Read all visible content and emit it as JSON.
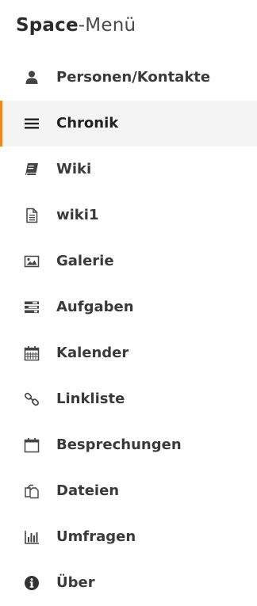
{
  "header": {
    "title_strong": "Space",
    "title_light": "-Menü"
  },
  "menu": {
    "items": [
      {
        "label": "Personen/Kontakte",
        "icon": "user-icon",
        "active": false
      },
      {
        "label": "Chronik",
        "icon": "bars-icon",
        "active": true
      },
      {
        "label": "Wiki",
        "icon": "book-icon",
        "active": false
      },
      {
        "label": "wiki1",
        "icon": "file-text-icon",
        "active": false
      },
      {
        "label": "Galerie",
        "icon": "image-icon",
        "active": false
      },
      {
        "label": "Aufgaben",
        "icon": "tasks-icon",
        "active": false
      },
      {
        "label": "Kalender",
        "icon": "calendar-icon",
        "active": false
      },
      {
        "label": "Linkliste",
        "icon": "link-icon",
        "active": false
      },
      {
        "label": "Besprechungen",
        "icon": "calendar-o-icon",
        "active": false
      },
      {
        "label": "Dateien",
        "icon": "files-icon",
        "active": false
      },
      {
        "label": "Umfragen",
        "icon": "bar-chart-icon",
        "active": false
      },
      {
        "label": "Über",
        "icon": "info-circle-icon",
        "active": false
      }
    ]
  },
  "colors": {
    "accent": "#eb8a24",
    "active_bg": "#f4f4f4",
    "text": "#3a3a3a"
  }
}
